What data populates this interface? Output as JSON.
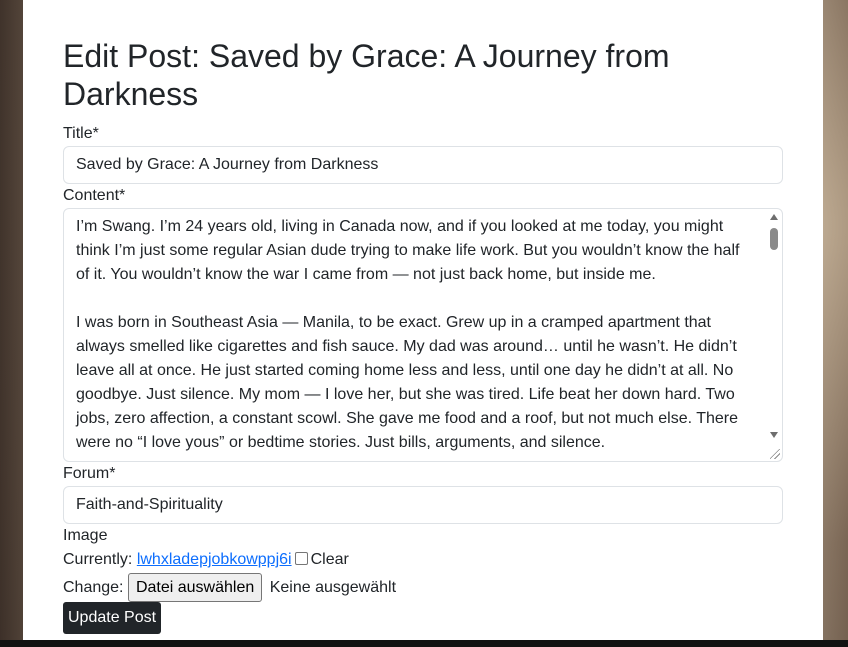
{
  "heading": "Edit Post: Saved by Grace: A Journey from Darkness",
  "form": {
    "title_label": "Title*",
    "title_value": "Saved by Grace: A Journey from Darkness",
    "content_label": "Content*",
    "content_value": "I’m Swang. I’m 24 years old, living in Canada now, and if you looked at me today, you might think I’m just some regular Asian dude trying to make life work. But you wouldn’t know the half of it. You wouldn’t know the war I came from — not just back home, but inside me.\n\nI was born in Southeast Asia — Manila, to be exact. Grew up in a cramped apartment that always smelled like cigarettes and fish sauce. My dad was around… until he wasn’t. He didn’t leave all at once. He just started coming home less and less, until one day he didn’t at all. No goodbye. Just silence. My mom — I love her, but she was tired. Life beat her down hard. Two jobs, zero affection, a constant scowl. She gave me food and a roof, but not much else. There were no “I love yous” or bedtime stories. Just bills, arguments, and silence.",
    "forum_label": "Forum*",
    "forum_value": "Faith-and-Spirituality",
    "image_label": "Image",
    "currently_label": "Currently:",
    "current_file": "lwhxladepjobkowppj6i",
    "clear_label": "Clear",
    "change_label": "Change:",
    "file_button": "Datei auswählen",
    "no_file": "Keine ausgewählt",
    "submit_label": "Update Post"
  },
  "colors": {
    "link": "#0d6efd",
    "button_bg": "#212529",
    "text": "#212529"
  }
}
